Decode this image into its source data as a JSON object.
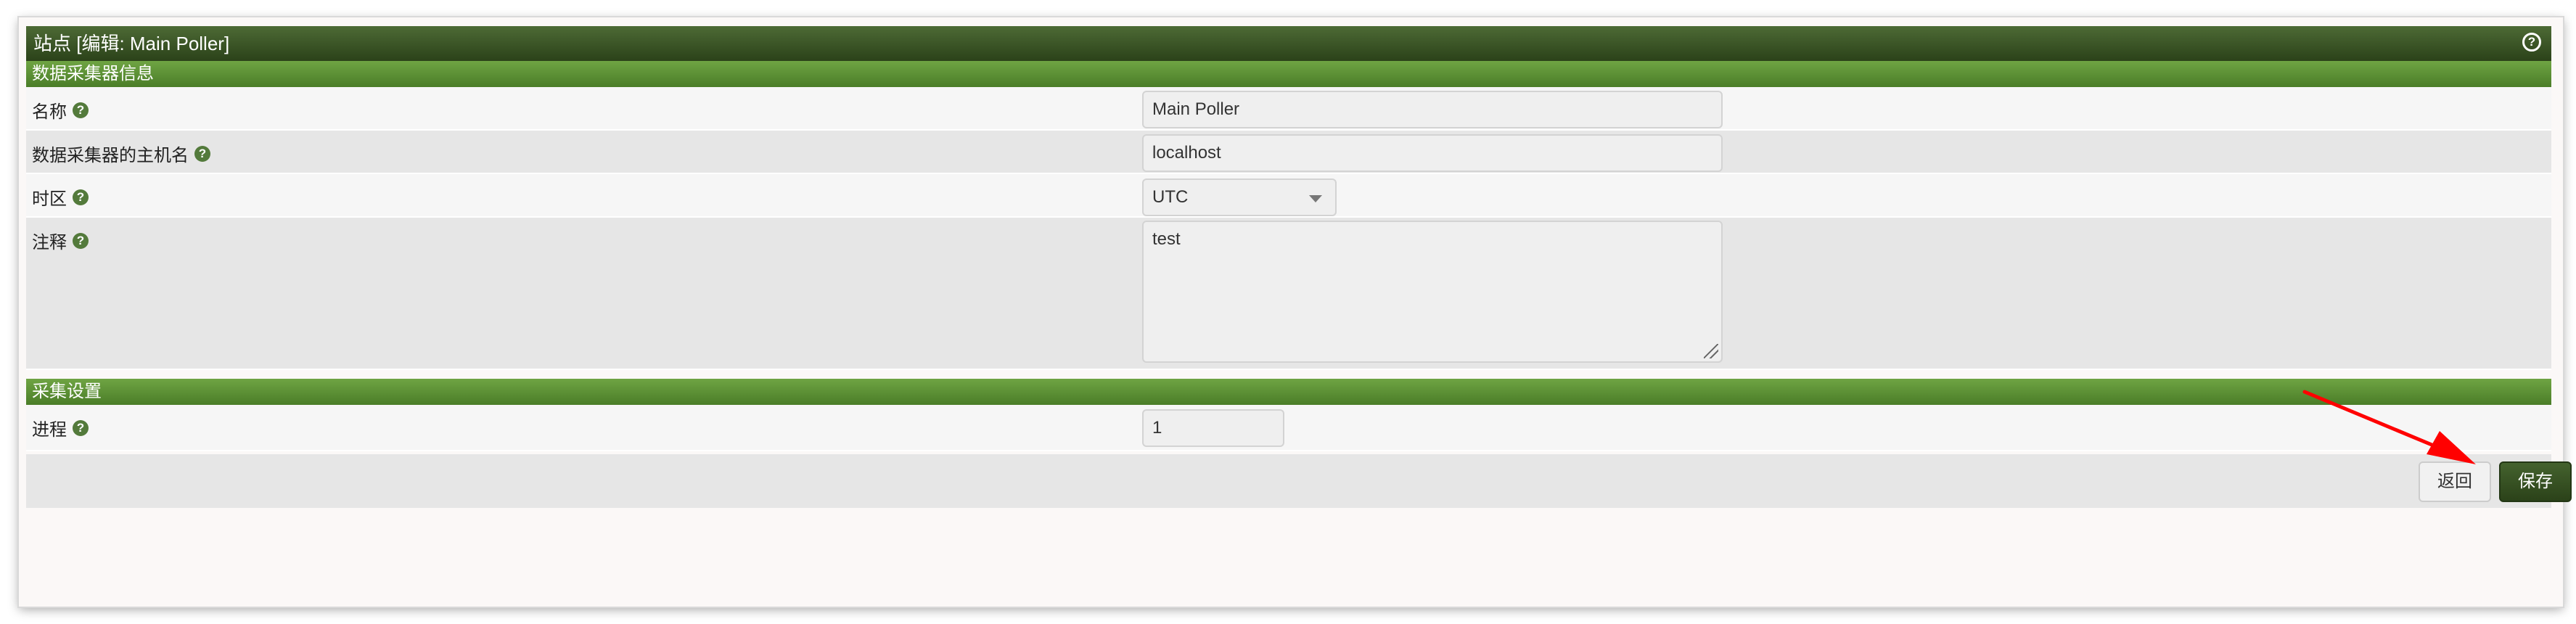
{
  "header": {
    "title": "站点 [编辑: Main Poller]",
    "help_icon": "question-circle-icon"
  },
  "sections": {
    "collector_info": "数据采集器信息",
    "collection_settings": "采集设置"
  },
  "fields": {
    "name": {
      "label": "名称",
      "value": "Main Poller"
    },
    "hostname": {
      "label": "数据采集器的主机名",
      "value": "localhost"
    },
    "timezone": {
      "label": "时区",
      "value": "UTC"
    },
    "notes": {
      "label": "注释",
      "value": "test"
    },
    "processes": {
      "label": "进程",
      "value": "1"
    }
  },
  "buttons": {
    "back": "返回",
    "save": "保存"
  },
  "colors": {
    "header": "#2b4219",
    "section": "#5a8f32",
    "annotation_arrow": "#ff0000"
  }
}
